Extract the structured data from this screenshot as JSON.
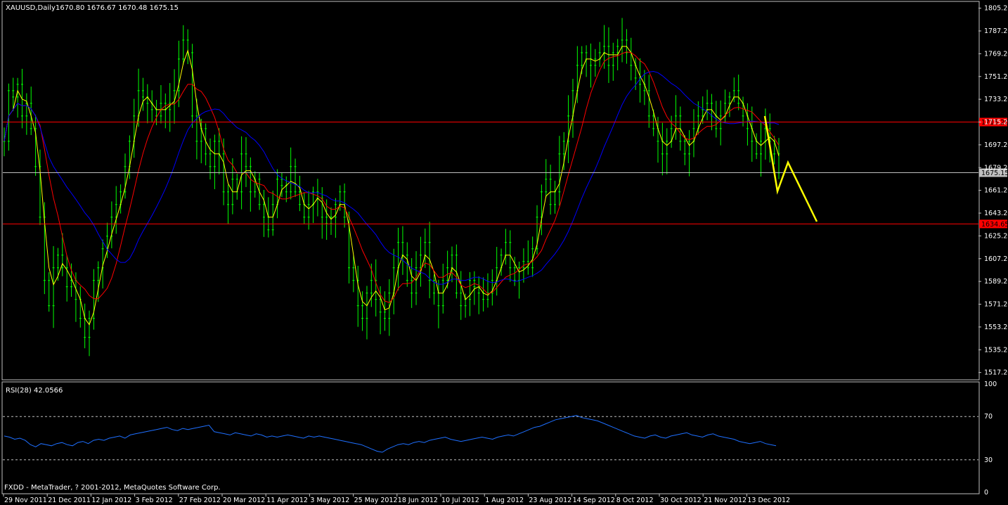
{
  "chart_data": {
    "type": "line",
    "symbol_header": "XAUUSD,Daily",
    "ohlc_header": "1670.80 1676.67 1670.48 1675.15",
    "price_axis": {
      "ylim": [
        1512,
        1810
      ],
      "ticks": [
        "1805.20",
        "1787.20",
        "1769.20",
        "1751.20",
        "1733.20",
        "1715.20",
        "1697.20",
        "1679.20",
        "1661.20",
        "1643.20",
        "1625.20",
        "1607.20",
        "1589.20",
        "1571.20",
        "1553.20",
        "1535.20",
        "1517.20"
      ]
    },
    "horizontal_lines": [
      {
        "label": "1715.20",
        "value": 1715.2,
        "color": "#ff0000",
        "boxed": true
      },
      {
        "label": "1675.15",
        "value": 1675.15,
        "color": "#c0c0c0",
        "boxed": true
      },
      {
        "label": "1634.65",
        "value": 1634.65,
        "color": "#ff0000",
        "boxed": true
      }
    ],
    "date_ticks": [
      "29 Nov 2011",
      "21 Dec 2011",
      "12 Jan 2012",
      "3 Feb 2012",
      "27 Feb 2012",
      "20 Mar 2012",
      "11 Apr 2012",
      "3 May 2012",
      "25 May 2012",
      "18 Jun 2012",
      "10 Jul 2012",
      "1 Aug 2012",
      "23 Aug 2012",
      "14 Sep 2012",
      "8 Oct 2012",
      "30 Oct 2012",
      "21 Nov 2012",
      "13 Dec 2012"
    ],
    "price_series": {
      "name": "XAUUSD close",
      "color": "#00ff00",
      "x": [
        0,
        1,
        2,
        3,
        4,
        5,
        6,
        7,
        8,
        9,
        10,
        11,
        12,
        13,
        14,
        15,
        16,
        17,
        18,
        19,
        20,
        21,
        22,
        23,
        24,
        25,
        26,
        27,
        28,
        29,
        30,
        31,
        32,
        33,
        34,
        35,
        36,
        37,
        38,
        39,
        40,
        41,
        42,
        43,
        44,
        45,
        46,
        47,
        48,
        49,
        50,
        51,
        52,
        53,
        54,
        55,
        56,
        57,
        58,
        59,
        60,
        61,
        62,
        63,
        64,
        65,
        66,
        67,
        68,
        69,
        70,
        71,
        72,
        73,
        74,
        75,
        76,
        77,
        78,
        79,
        80,
        81,
        82,
        83,
        84,
        85,
        86,
        87,
        88,
        89,
        90,
        91,
        92,
        93,
        94,
        95,
        96,
        97,
        98,
        99,
        100,
        101,
        102,
        103,
        104,
        105,
        106,
        107,
        108,
        109,
        110,
        111,
        112,
        113,
        114,
        115,
        116,
        117,
        118,
        119,
        120,
        121,
        122,
        123,
        124,
        125,
        126,
        127,
        128,
        129,
        130,
        131,
        132,
        133,
        134,
        135,
        136,
        137,
        138,
        139,
        140,
        141,
        142,
        143,
        144,
        145,
        146,
        147,
        148,
        149,
        150,
        151,
        152,
        153,
        154,
        155,
        156,
        157,
        158,
        159,
        160,
        161,
        162,
        163,
        164,
        165,
        166,
        167,
        168,
        169,
        170,
        171,
        172,
        173,
        174,
        175,
        176,
        177,
        178,
        179,
        180,
        181,
        182,
        183,
        184,
        185,
        186,
        187,
        188,
        189,
        190,
        191,
        192,
        193,
        194,
        195,
        196,
        197,
        198,
        199,
        200,
        201,
        202,
        203,
        204,
        205,
        206,
        207,
        208,
        209,
        210,
        211,
        212,
        213,
        214,
        215,
        216,
        217,
        218,
        219,
        220,
        221,
        222,
        223,
        224,
        225,
        226,
        227,
        228,
        229,
        230,
        231,
        232,
        233,
        234,
        235,
        236,
        237,
        238,
        239,
        240,
        241,
        242,
        243,
        244,
        245,
        246,
        247,
        248,
        249,
        250,
        251,
        252,
        253,
        254,
        255,
        256,
        257,
        258,
        259,
        260,
        261,
        262,
        263,
        264,
        265,
        266,
        267,
        268,
        269,
        270
      ],
      "values": [
        1700,
        1740,
        1735,
        1745,
        1720,
        1730,
        1710,
        1680,
        1640,
        1590,
        1570,
        1600,
        1610,
        1600,
        1585,
        1590,
        1575,
        1560,
        1545,
        1560,
        1590,
        1600,
        1615,
        1625,
        1640,
        1650,
        1660,
        1680,
        1700,
        1720,
        1740,
        1735,
        1730,
        1725,
        1720,
        1730,
        1725,
        1730,
        1740,
        1765,
        1780,
        1770,
        1720,
        1700,
        1710,
        1690,
        1680,
        1700,
        1690,
        1660,
        1650,
        1670,
        1660,
        1690,
        1680,
        1660,
        1670,
        1650,
        1640,
        1630,
        1650,
        1670,
        1665,
        1660,
        1680,
        1660,
        1650,
        1640,
        1650,
        1660,
        1655,
        1640,
        1635,
        1640,
        1650,
        1660,
        1640,
        1600,
        1590,
        1570,
        1560,
        1580,
        1590,
        1575,
        1565,
        1560,
        1580,
        1600,
        1620,
        1610,
        1590,
        1580,
        1600,
        1610,
        1620,
        1590,
        1580,
        1570,
        1590,
        1600,
        1610,
        1580,
        1570,
        1575,
        1590,
        1585,
        1580,
        1575,
        1580,
        1590,
        1600,
        1610,
        1620,
        1600,
        1590,
        1600,
        1605,
        1600,
        1615,
        1640,
        1660,
        1670,
        1650,
        1660,
        1690,
        1700,
        1720,
        1740,
        1760,
        1770,
        1765,
        1760,
        1765,
        1770,
        1775,
        1760,
        1770,
        1775,
        1780,
        1770,
        1760,
        1750,
        1745,
        1740,
        1720,
        1710,
        1700,
        1690,
        1700,
        1710,
        1720,
        1700,
        1690,
        1700,
        1710,
        1720,
        1725,
        1730,
        1720,
        1710,
        1720,
        1730,
        1735,
        1740,
        1730,
        1720,
        1710,
        1700,
        1690,
        1700,
        1710,
        1700,
        1690,
        1675
      ],
      "candles": true
    },
    "ma_series": [
      {
        "color": "#ffff00",
        "period": "fast"
      },
      {
        "color": "#ff0000",
        "period": "mid"
      },
      {
        "color": "#0000ff",
        "period": "slow"
      }
    ],
    "projection": {
      "color": "#ffff00",
      "points": [
        [
          1088,
          165
        ],
        [
          1096,
          212
        ],
        [
          1106,
          272
        ],
        [
          1121,
          231
        ],
        [
          1162,
          315
        ]
      ]
    },
    "rsi": {
      "header": "RSI(28) 42.0566",
      "ylim": [
        0,
        100
      ],
      "levels": [
        70,
        30
      ],
      "ticks": [
        "100",
        "70",
        "30",
        "0"
      ],
      "color": "#1e6fff",
      "values": [
        52,
        51,
        49,
        50,
        48,
        44,
        42,
        45,
        44,
        43,
        45,
        46,
        44,
        43,
        46,
        47,
        45,
        48,
        49,
        48,
        50,
        51,
        52,
        50,
        53,
        54,
        55,
        56,
        57,
        58,
        59,
        60,
        58,
        57,
        59,
        58,
        59,
        60,
        61,
        62,
        56,
        55,
        54,
        53,
        55,
        54,
        53,
        52,
        54,
        53,
        51,
        52,
        51,
        52,
        53,
        52,
        51,
        50,
        52,
        51,
        52,
        51,
        50,
        49,
        48,
        47,
        46,
        45,
        44,
        42,
        40,
        38,
        37,
        40,
        42,
        44,
        45,
        44,
        46,
        47,
        46,
        48,
        49,
        50,
        51,
        49,
        48,
        47,
        48,
        49,
        50,
        51,
        50,
        49,
        51,
        52,
        53,
        52,
        54,
        56,
        58,
        60,
        61,
        63,
        65,
        67,
        68,
        69,
        70,
        71,
        69,
        68,
        67,
        66,
        64,
        62,
        60,
        58,
        56,
        54,
        52,
        51,
        50,
        52,
        53,
        51,
        50,
        52,
        53,
        54,
        55,
        53,
        52,
        51,
        53,
        54,
        52,
        51,
        50,
        49,
        47,
        46,
        45,
        46,
        47,
        45,
        44,
        43
      ]
    },
    "footer": "FXDD - MetaTrader, ? 2001-2012, MetaQuotes Software Corp."
  }
}
